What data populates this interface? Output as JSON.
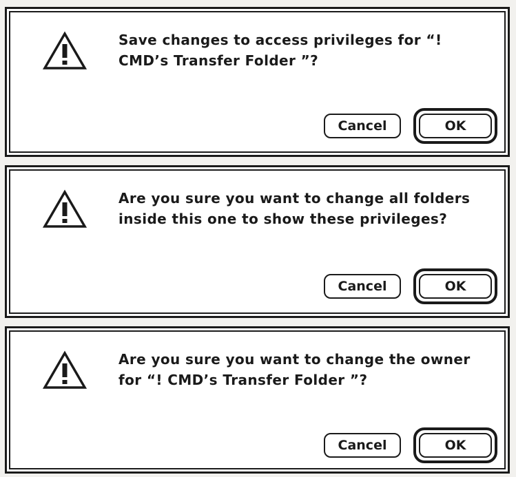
{
  "dialogs": [
    {
      "icon": "caution-triangle-icon",
      "message": "Save changes to access privileges for “! CMD’s Transfer Folder ”?",
      "cancel_label": "Cancel",
      "ok_label": "OK"
    },
    {
      "icon": "caution-triangle-icon",
      "message": "Are you sure you want to change all folders inside this one to show these privileges?",
      "cancel_label": "Cancel",
      "ok_label": "OK"
    },
    {
      "icon": "caution-triangle-icon",
      "message": "Are you sure you want to change the owner for “! CMD’s Transfer Folder ”?",
      "cancel_label": "Cancel",
      "ok_label": "OK"
    }
  ],
  "colors": {
    "frame": "#1a1a1a",
    "dialog_background": "#ffffff",
    "page_background": "#f2f1ee"
  }
}
